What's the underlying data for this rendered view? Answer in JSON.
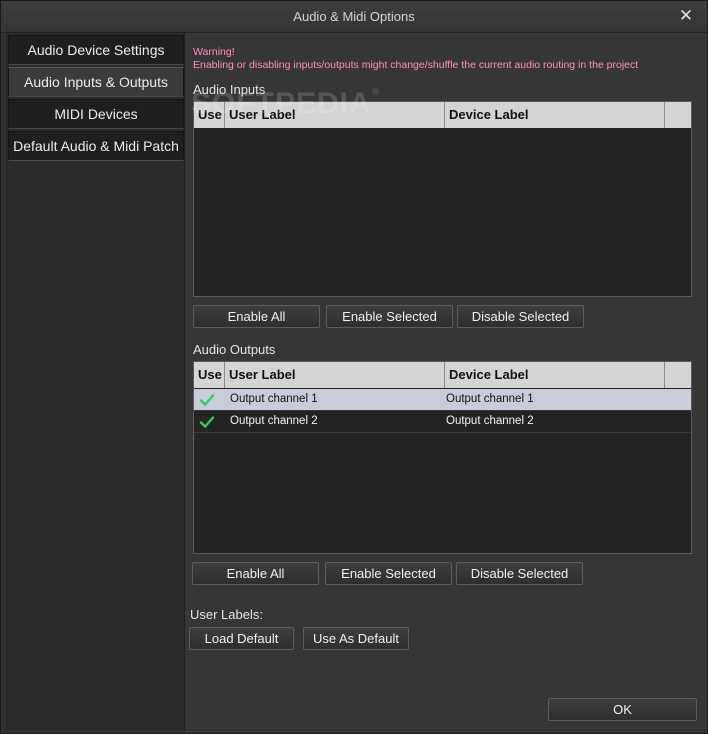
{
  "window": {
    "title": "Audio & Midi Options",
    "close_glyph": "✕"
  },
  "sidebar": {
    "items": [
      {
        "label": "Audio Device Settings"
      },
      {
        "label": "Audio Inputs & Outputs"
      },
      {
        "label": "MIDI Devices"
      },
      {
        "label": "Default Audio & Midi Patch"
      }
    ],
    "active_index": 1
  },
  "warning": {
    "line1": "Warning!",
    "line2": "Enabling or disabling inputs/outputs might change/shuffle the current audio routing in the project"
  },
  "watermark": {
    "text": "SOFTPEDIA",
    "mark": "®"
  },
  "inputs": {
    "title": "Audio Inputs",
    "columns": {
      "use": "Use",
      "user_label": "User Label",
      "device_label": "Device Label"
    },
    "rows": [],
    "buttons": {
      "enable_all": "Enable All",
      "enable_selected": "Enable Selected",
      "disable_selected": "Disable Selected"
    }
  },
  "outputs": {
    "title": "Audio Outputs",
    "columns": {
      "use": "Use",
      "user_label": "User Label",
      "device_label": "Device Label"
    },
    "rows": [
      {
        "use": true,
        "user_label": "Output channel 1",
        "device_label": "Output channel 1",
        "selected": true
      },
      {
        "use": true,
        "user_label": "Output channel 2",
        "device_label": "Output channel 2",
        "selected": false
      }
    ],
    "buttons": {
      "enable_all": "Enable All",
      "enable_selected": "Enable Selected",
      "disable_selected": "Disable Selected"
    }
  },
  "user_labels": {
    "title": "User Labels:",
    "load_default": "Load Default",
    "use_as_default": "Use As Default"
  },
  "footer": {
    "ok": "OK"
  },
  "colors": {
    "check": "#2fd15a",
    "warning": "#ff8fc0",
    "selected_row": "#c7cdd9"
  },
  "icons": {
    "check": "check-icon",
    "close": "close-icon"
  }
}
